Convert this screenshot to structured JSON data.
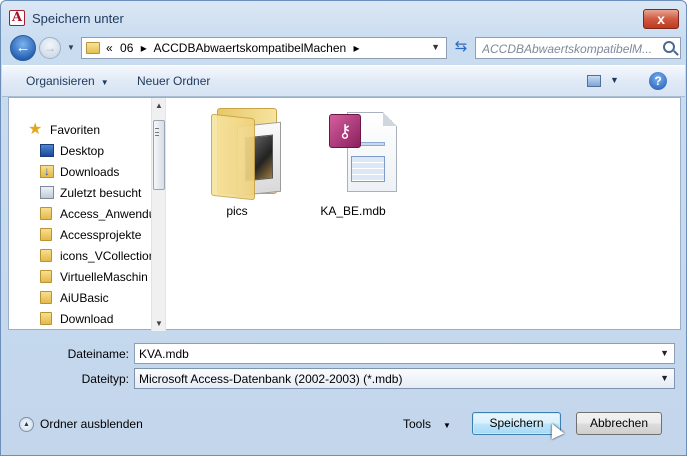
{
  "window": {
    "title": "Speichern unter",
    "app_icon_letter": "A",
    "close_symbol": "x"
  },
  "nav": {
    "back_symbol": "←",
    "forward_symbol": "→",
    "breadcrumb": [
      "«",
      "06",
      "▸",
      "ACCDBAbwaertskompatibelMachen",
      "▸"
    ],
    "search_placeholder": "ACCDBAbwaertskompatibelM..."
  },
  "toolbar": {
    "organize": "Organisieren",
    "new_folder": "Neuer Ordner",
    "help": "?"
  },
  "sidebar": {
    "items": [
      {
        "label": "Favoriten",
        "icon": "star-icon"
      },
      {
        "label": "Desktop",
        "icon": "desktop-icon"
      },
      {
        "label": "Downloads",
        "icon": "downloads-icon"
      },
      {
        "label": "Zuletzt besucht",
        "icon": "recent-icon"
      },
      {
        "label": "Access_Anwendu",
        "icon": "folder-icon"
      },
      {
        "label": "Accessprojekte",
        "icon": "folder-icon"
      },
      {
        "label": "icons_VCollection",
        "icon": "folder-icon"
      },
      {
        "label": "VirtuelleMaschin",
        "icon": "folder-icon"
      },
      {
        "label": "AiUBasic",
        "icon": "folder-icon"
      },
      {
        "label": "Download",
        "icon": "folder-icon"
      }
    ]
  },
  "files": [
    {
      "name": "pics",
      "icon": "folder-icon"
    },
    {
      "name": "KA_BE.mdb",
      "icon": "access-database-icon"
    }
  ],
  "form": {
    "filename_label": "Dateiname:",
    "filename_value": "KVA.mdb",
    "filetype_label": "Dateityp:",
    "filetype_value": "Microsoft Access-Datenbank (2002-2003) (*.mdb)"
  },
  "footer": {
    "hide_folders": "Ordner ausblenden",
    "tools": "Tools",
    "save": "Speichern",
    "cancel": "Abbrechen"
  }
}
